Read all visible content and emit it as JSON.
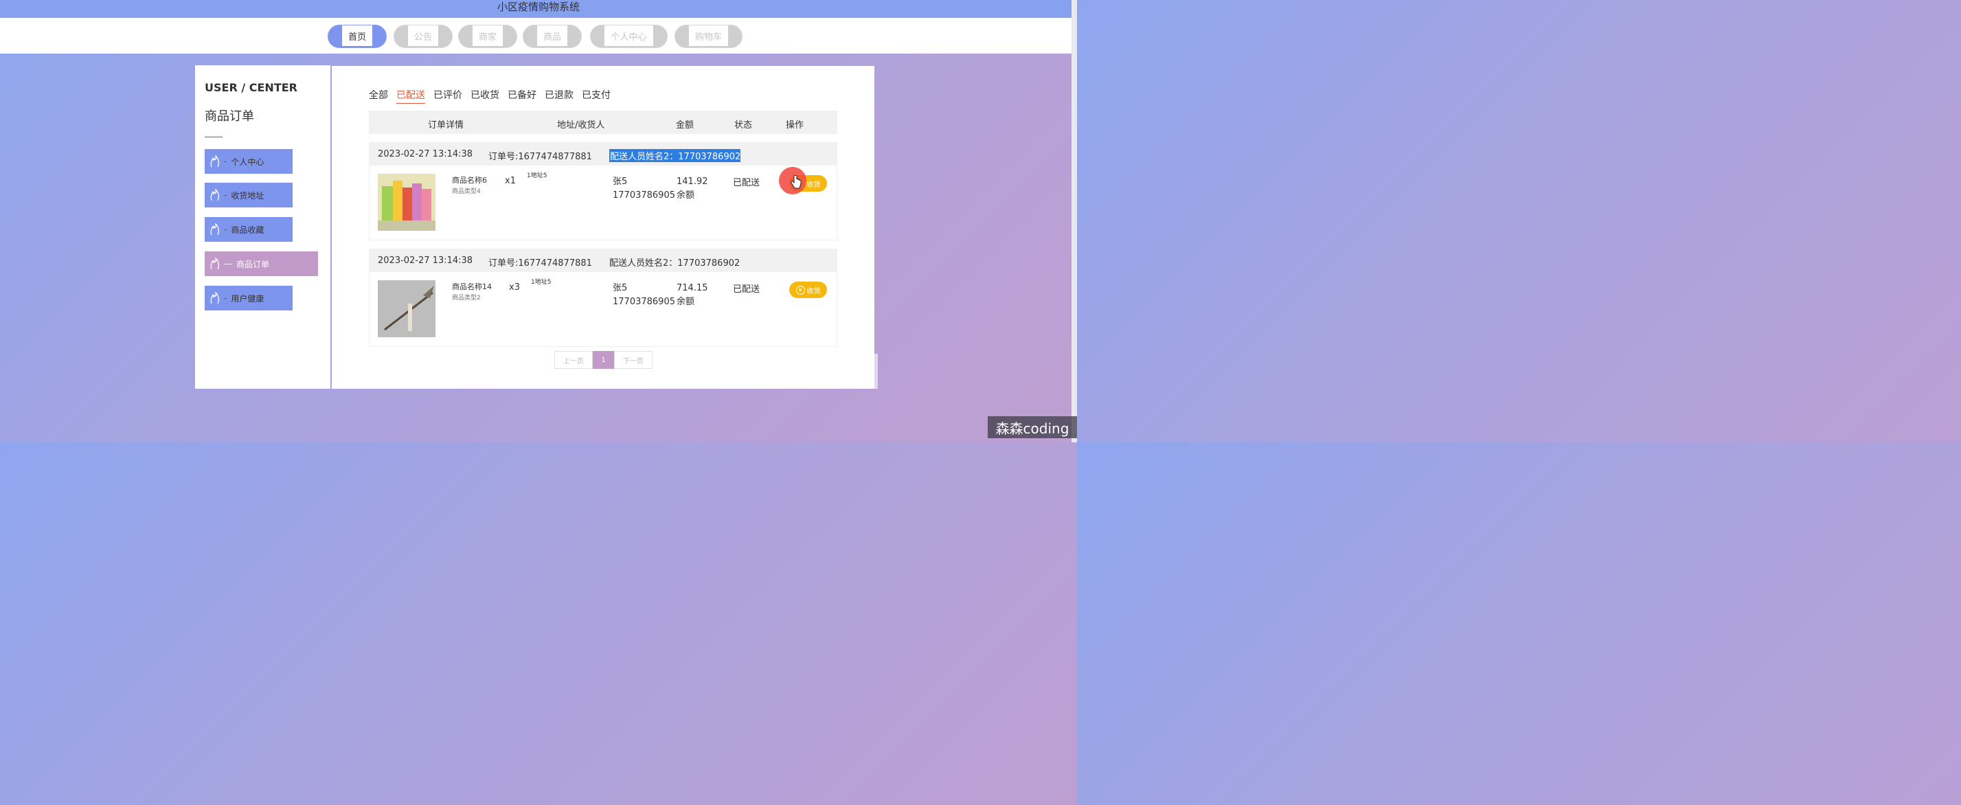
{
  "app": {
    "title": "小区疫情购物系统"
  },
  "nav": {
    "items": [
      {
        "label": "首页",
        "active": true
      },
      {
        "label": "公告"
      },
      {
        "label": "商家"
      },
      {
        "label": "商品"
      },
      {
        "label": "个人中心"
      },
      {
        "label": "购物车"
      }
    ]
  },
  "sidebar": {
    "header": "USER / CENTER",
    "section_title": "商品订单",
    "items": [
      {
        "label": "个人中心"
      },
      {
        "label": "收货地址"
      },
      {
        "label": "商品收藏"
      },
      {
        "label": "商品订单",
        "active": true
      },
      {
        "label": "用户健康"
      }
    ]
  },
  "tabs": [
    "全部",
    "已配送",
    "已评价",
    "已收货",
    "已备好",
    "已退款",
    "已支付"
  ],
  "table": {
    "headers": [
      "订单详情",
      "地址/收货人",
      "金额",
      "状态",
      "操作"
    ]
  },
  "orders": [
    {
      "time": "2023-02-27 13:14:38",
      "order_no": "订单号:1677474877881",
      "courier": "配送人员姓名2：17703786902",
      "product_name": "商品名称6",
      "product_type": "商品类型4",
      "qty": "x1",
      "address": "1地址5",
      "receiver_name": "张5",
      "receiver_phone": "17703786905",
      "amount": "141.92",
      "pay_method": "余额",
      "status": "已配送",
      "action": "收货"
    },
    {
      "time": "2023-02-27 13:14:38",
      "order_no": "订单号:1677474877881",
      "courier": "配送人员姓名2：17703786902",
      "product_name": "商品名称14",
      "product_type": "商品类型2",
      "qty": "x3",
      "address": "1地址5",
      "receiver_name": "张5",
      "receiver_phone": "17703786905",
      "amount": "714.15",
      "pay_method": "余额",
      "status": "已配送",
      "action": "收货"
    }
  ],
  "pager": {
    "prev": "上一页",
    "current": "1",
    "next": "下一页"
  },
  "watermark": "森森coding",
  "colors": {
    "accent": "#7e95ee",
    "active_side": "#c19ac9",
    "action_button": "#f5b80e",
    "tab_active": "#e05a3a"
  }
}
